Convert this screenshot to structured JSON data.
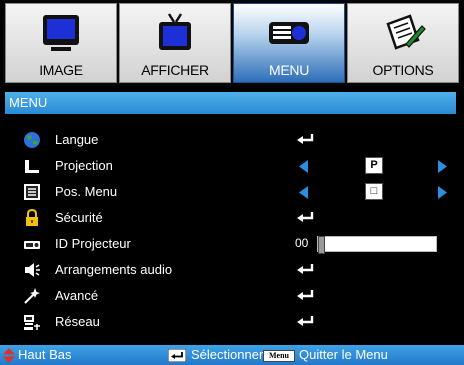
{
  "tabs": [
    {
      "label": "IMAGE",
      "icon": "monitor-icon",
      "active": false
    },
    {
      "label": "AFFICHER",
      "icon": "tv-icon",
      "active": false
    },
    {
      "label": "MENU",
      "icon": "projector-icon",
      "active": true
    },
    {
      "label": "OPTIONS",
      "icon": "document-pen-icon",
      "active": false
    }
  ],
  "section_title": "MENU",
  "rows": [
    {
      "label": "Langue",
      "icon": "globe-icon",
      "control": "enter"
    },
    {
      "label": "Projection",
      "icon": "projection-icon",
      "control": "selector",
      "value": "P"
    },
    {
      "label": "Pos. Menu",
      "icon": "menu-position-icon",
      "control": "selector",
      "value": "□"
    },
    {
      "label": "Sécurité",
      "icon": "lock-icon",
      "control": "enter"
    },
    {
      "label": "ID Projecteur",
      "icon": "projector-id-icon",
      "control": "slider",
      "value": "00",
      "level": 0
    },
    {
      "label": "Arrangements audio",
      "icon": "speaker-icon",
      "control": "enter"
    },
    {
      "label": "Avancé",
      "icon": "advanced-icon",
      "control": "enter"
    },
    {
      "label": "Réseau",
      "icon": "network-icon",
      "control": "enter"
    }
  ],
  "footer": {
    "nav_label": "Haut Bas",
    "select_label": "Sélectionner",
    "menu_key": "Menu",
    "exit_label": "Quitter le Menu"
  },
  "colors": {
    "accent_blue": "#2a8bd6",
    "arrow_blue": "#2b8fe0",
    "nav_red": "#e03030"
  }
}
